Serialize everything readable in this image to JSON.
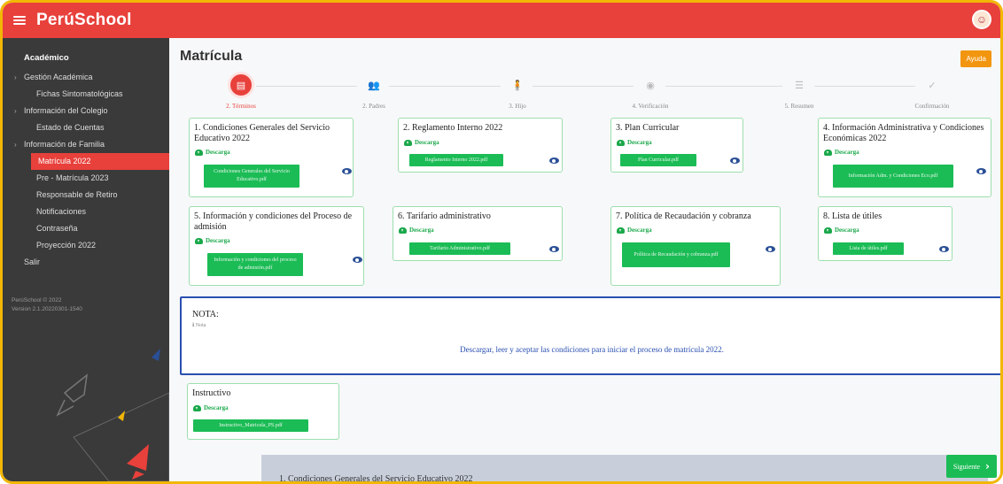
{
  "app": {
    "brand": "PerúSchool"
  },
  "sidebar": {
    "section": "Académico",
    "items": [
      {
        "label": "Gestión Académica",
        "level": 1,
        "caret": true
      },
      {
        "label": "Fichas Sintomatológicas",
        "level": 2
      },
      {
        "label": "Información del Colegio",
        "level": 1,
        "caret": true
      },
      {
        "label": "Estado de Cuentas",
        "level": 2
      },
      {
        "label": "Información de Familia",
        "level": 1,
        "caret": true
      },
      {
        "label": "Matrícula 2022",
        "level": 2,
        "active": true
      },
      {
        "label": "Pre - Matrícula 2023",
        "level": 2
      },
      {
        "label": "Responsable de Retiro",
        "level": 2
      },
      {
        "label": "Notificaciones",
        "level": 2
      },
      {
        "label": "Contraseña",
        "level": 2
      },
      {
        "label": "Proyección 2022",
        "level": 2
      },
      {
        "label": "Salir",
        "level": 0
      }
    ],
    "version_line1": "PerúSchool © 2022",
    "version_line2": "Version 2.1.20220301-1540"
  },
  "main": {
    "title": "Matrícula",
    "help_label": "Ayuda",
    "steps": [
      {
        "label": "2. Términos",
        "icon": "document-icon",
        "glyph": "▤",
        "active": true
      },
      {
        "label": "2. Padres",
        "icon": "people-icon",
        "glyph": "👥"
      },
      {
        "label": "3. Hijo",
        "icon": "child-icon",
        "glyph": "🧍"
      },
      {
        "label": "4. Verificación",
        "icon": "eye-icon",
        "glyph": "◉"
      },
      {
        "label": "5. Resumen",
        "icon": "list-icon",
        "glyph": "☰"
      },
      {
        "label": "Confirmación",
        "icon": "check-icon",
        "glyph": "✓"
      }
    ],
    "download_label": "Descarga",
    "cards": [
      {
        "title": "1. Condiciones Generales del Servicio Educativo 2022",
        "file": "Condiciones Generales del Servicio Educativo.pdf"
      },
      {
        "title": "2. Reglamento Interno 2022",
        "file": "Reglamento Interno 2022.pdf"
      },
      {
        "title": "3. Plan Curricular",
        "file": "Plan Curricular.pdf"
      },
      {
        "title": "4. Información Administrativa y Condiciones Económicas 2022",
        "file": "Información Adm. y Condiciones Eco.pdf"
      },
      {
        "title": "5. Información y condiciones del Proceso de admisión",
        "file": "Información y condiciones del proceso de admisión.pdf"
      },
      {
        "title": "6. Tarifario administrativo",
        "file": "Tarifario Administrativo.pdf"
      },
      {
        "title": "7. Política de Recaudación y cobranza",
        "file": "Política de Recaudación y cobranza.pdf"
      },
      {
        "title": "8. Lista de útiles",
        "file": "Lista de útiles.pdf"
      },
      {
        "title": "Instructivo",
        "file": "Instructivo_Matricula_PS.pdf"
      }
    ],
    "note": {
      "title": "NOTA:",
      "sub": "Nota",
      "message": "Descargar, leer y aceptar las condiciones para iniciar el proceso de matrícula 2022."
    },
    "next_label": "Siguiente",
    "bottom_text": "1. Condiciones Generales del Servicio Educativo 2022"
  },
  "colors": {
    "brand_red": "#e8403b",
    "green": "#1bbc55",
    "note_blue": "#2a4fb0",
    "help_orange": "#f2950f"
  }
}
